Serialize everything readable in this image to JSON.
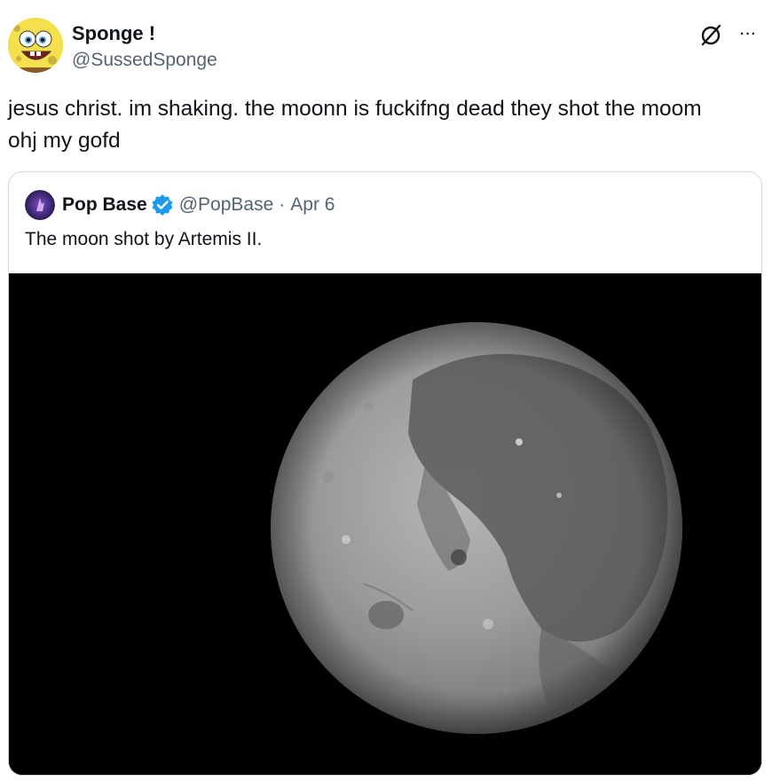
{
  "tweet": {
    "author_name": "Sponge !",
    "author_handle": "@SussedSponge",
    "avatar_icon": "spongebob-avatar",
    "text": "jesus christ. im shaking. the moonn is fuckifng dead they shot the moom\nohj my gofd"
  },
  "header_actions": {
    "grok_icon": "grok-icon",
    "more_icon": "more-options-icon",
    "more_label": "···"
  },
  "quoted_tweet": {
    "author_name": "Pop Base",
    "author_handle": "@PopBase",
    "separator": "·",
    "date": "Apr 6",
    "verified": true,
    "verified_color": "#1d9bf0",
    "text": "The moon shot by Artemis II.",
    "media": {
      "description_icon": "moon-photo",
      "background": "#000000"
    }
  },
  "colors": {
    "text_primary": "#0f1419",
    "text_secondary": "#536471",
    "border": "#cfd9de"
  }
}
